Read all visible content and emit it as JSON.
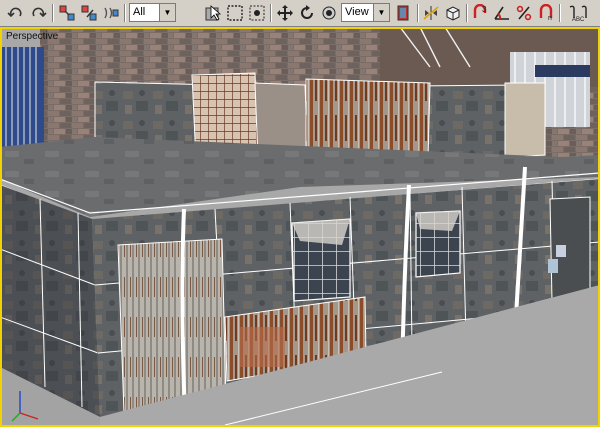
{
  "toolbar": {
    "selection_filter": "All",
    "reference_coord": "View",
    "icons": [
      "undo-icon",
      "redo-icon",
      "link-icon",
      "unlink-icon",
      "bind-space-warp-icon",
      "select-object-icon",
      "select-by-name-icon",
      "rect-selection-region-icon",
      "window-crossing-icon",
      "select-move-icon",
      "select-rotate-icon",
      "pivot-center-icon",
      "mirror-icon",
      "align-icon",
      "snaps-toggle-icon",
      "angle-snap-icon",
      "percent-snap-icon",
      "spinner-snap-icon",
      "named-selection-icon"
    ],
    "snap_value": "3",
    "snap_value2": "n"
  },
  "viewport": {
    "label": "Perspective",
    "active_border_color": "#f2d200",
    "background_color": "#a8a8a8"
  },
  "colors": {
    "wire": "#ffffff",
    "concrete": "#6e7070",
    "brick": "#7c6a62",
    "rust": "#8a4a2a",
    "ground": "#a7a7a7"
  }
}
